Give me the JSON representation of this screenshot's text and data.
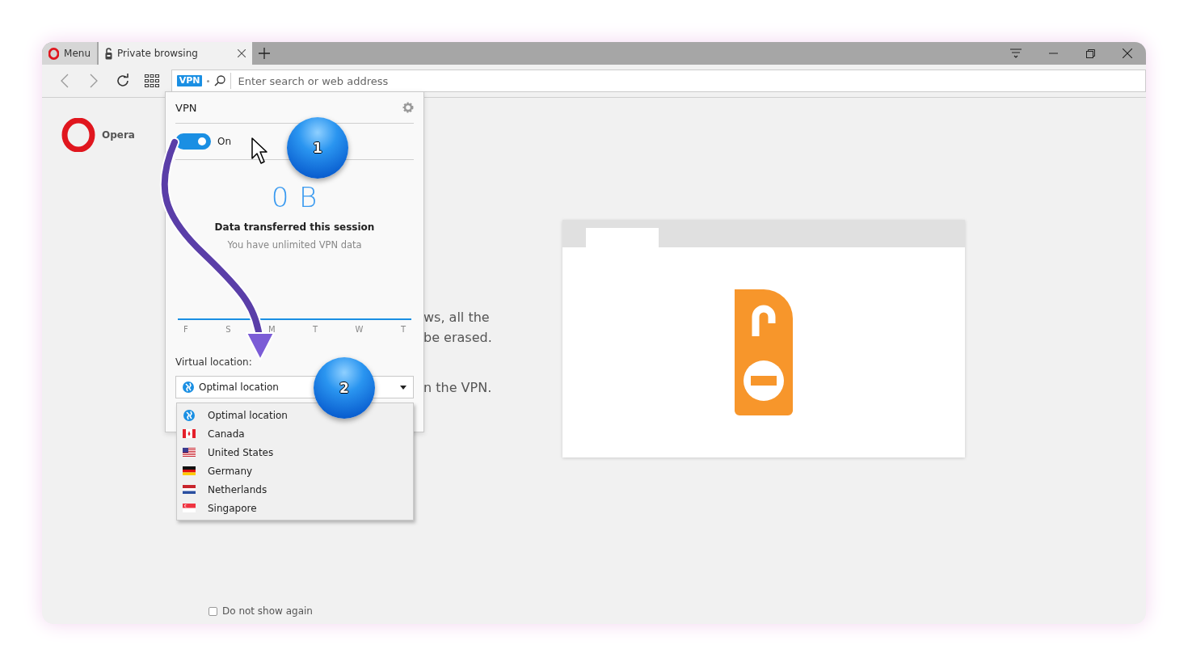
{
  "tabs": [
    {
      "kind": "menu",
      "label": "Menu",
      "selected": false
    },
    {
      "kind": "private",
      "label": "Private browsing",
      "selected": true
    }
  ],
  "address_bar": {
    "badge": "VPN",
    "placeholder": "Enter search or web address"
  },
  "sidebar_logo": {
    "label": "Opera"
  },
  "background_text": [
    "ws, all the",
    "be erased.",
    "n the VPN."
  ],
  "vpn_popup": {
    "title": "VPN",
    "toggle": {
      "label": "On",
      "on": true
    },
    "amount": "0 B",
    "caption": "Data transferred this session",
    "note": "You have unlimited VPN data",
    "days": [
      "F",
      "S",
      "M",
      "T",
      "W",
      "T"
    ],
    "location_label": "Virtual location:",
    "selected_location": "Optimal location",
    "locations": [
      {
        "kind": "globe",
        "label": "Optimal location"
      },
      {
        "kind": "canada",
        "label": "Canada"
      },
      {
        "kind": "usa",
        "label": "United States"
      },
      {
        "kind": "germany",
        "label": "Germany"
      },
      {
        "kind": "netherlands",
        "label": "Netherlands"
      },
      {
        "kind": "singapore",
        "label": "Singapore"
      }
    ]
  },
  "callouts": [
    "1",
    "2"
  ],
  "checkbox": {
    "label": "Do not show again",
    "checked": false
  }
}
